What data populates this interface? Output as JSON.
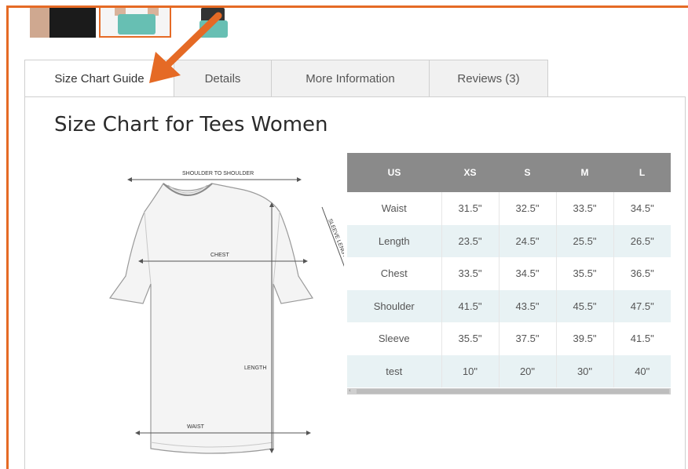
{
  "tabs": [
    {
      "label": "Size Chart Guide",
      "active": true
    },
    {
      "label": "Details",
      "active": false
    },
    {
      "label": "More Information",
      "active": false
    },
    {
      "label": "Reviews (3)",
      "active": false
    }
  ],
  "panel": {
    "title": "Size Chart for Tees Women"
  },
  "diagram": {
    "shoulder_label": "SHOULDER TO SHOULDER",
    "sleeve_label": "SLEEVE LENGTH",
    "chest_label": "CHEST",
    "length_label": "LENGTH",
    "waist_label": "WAIST"
  },
  "size_table": {
    "headers": [
      "US",
      "XS",
      "S",
      "M",
      "L"
    ],
    "rows": [
      [
        "Waist",
        "31.5\"",
        "32.5\"",
        "33.5\"",
        "34.5\""
      ],
      [
        "Length",
        "23.5\"",
        "24.5\"",
        "25.5\"",
        "26.5\""
      ],
      [
        "Chest",
        "33.5\"",
        "34.5\"",
        "35.5\"",
        "36.5\""
      ],
      [
        "Shoulder",
        "41.5\"",
        "43.5\"",
        "45.5\"",
        "47.5\""
      ],
      [
        "Sleeve",
        "35.5\"",
        "37.5\"",
        "39.5\"",
        "41.5\""
      ],
      [
        "test",
        "10\"",
        "20\"",
        "30\"",
        "40\""
      ]
    ]
  },
  "scrollbar": {
    "left_arrow_glyph": "‹"
  },
  "colors": {
    "accent": "#e56a25",
    "table_header": "#8a8a8a",
    "row_alt": "#e8f2f4"
  },
  "icons": {
    "annotation_arrow": "arrow-icon"
  }
}
